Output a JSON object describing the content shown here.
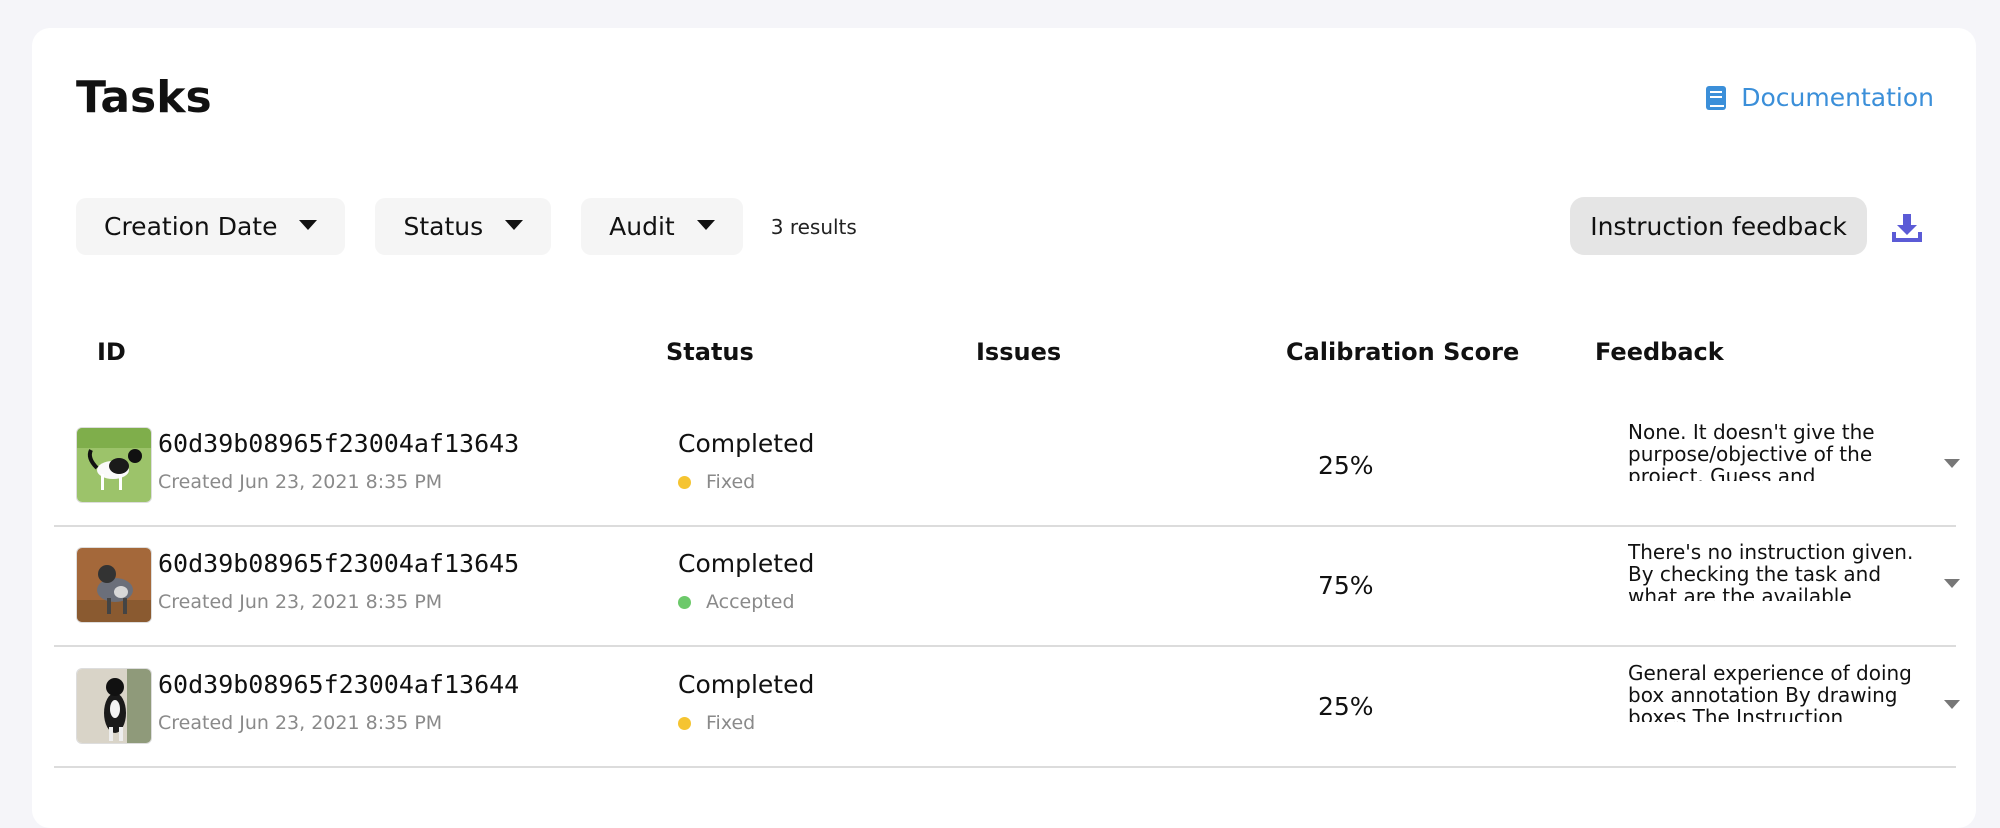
{
  "header": {
    "title": "Tasks",
    "doc_link": "Documentation"
  },
  "filters": {
    "creation_date": "Creation Date",
    "status": "Status",
    "audit": "Audit",
    "results": "3 results"
  },
  "toolbar": {
    "instruction_feedback": "Instruction feedback",
    "download_icon": "download-icon"
  },
  "table": {
    "columns": [
      "ID",
      "Status",
      "Issues",
      "Calibration Score",
      "Feedback"
    ],
    "rows": [
      {
        "id": "60d39b08965f23004af13643",
        "created": "Created Jun 23, 2021 8:35 PM",
        "status": "Completed",
        "badge": "Fixed",
        "badge_color": "#f5c431",
        "issues": "",
        "score": "25%",
        "feedback": "None. It doesn't give the purpose/objective of the project. Guess and preliminary. Usually..."
      },
      {
        "id": "60d39b08965f23004af13645",
        "created": "Created Jun 23, 2021 8:35 PM",
        "status": "Completed",
        "badge": "Accepted",
        "badge_color": "#6cc96a",
        "issues": "",
        "score": "75%",
        "feedback": "There's no instruction given. By checking the task and what are the available labels on the reference. Then I..."
      },
      {
        "id": "60d39b08965f23004af13644",
        "created": "Created Jun 23, 2021 8:35 PM",
        "status": "Completed",
        "badge": "Fixed",
        "badge_color": "#f5c431",
        "issues": "",
        "score": "25%",
        "feedback": "General experience of doing box annotation By drawing boxes The Instruction Doesn't Explain how to..."
      }
    ]
  },
  "colors": {
    "accent": "#3b8fd9",
    "download": "#5b5bd6"
  }
}
